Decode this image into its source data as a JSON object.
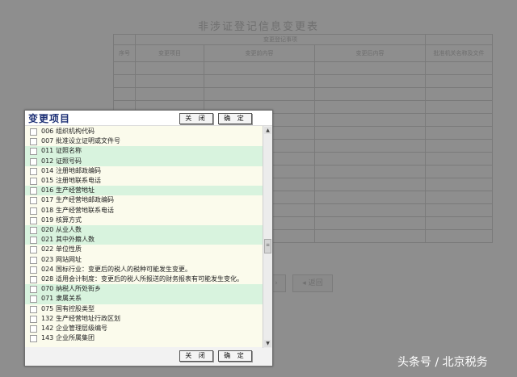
{
  "background_form": {
    "title": "非涉证登记信息变更表",
    "header_group": "变更登记事项",
    "columns": [
      "序号",
      "变更项目",
      "变更前内容",
      "变更后内容",
      "批准机关名称及文件"
    ],
    "button_right": "返回"
  },
  "dialog": {
    "title": "变更项目",
    "close_label": "关 闭",
    "ok_label": "确 定",
    "items": [
      {
        "code": "006",
        "name": "组织机构代码",
        "highlighted": false
      },
      {
        "code": "007",
        "name": "批准设立证明或文件号",
        "highlighted": false
      },
      {
        "code": "011",
        "name": "证照名称",
        "highlighted": true
      },
      {
        "code": "012",
        "name": "证照号码",
        "highlighted": true
      },
      {
        "code": "014",
        "name": "注册地邮政编码",
        "highlighted": false
      },
      {
        "code": "015",
        "name": "注册地联系电话",
        "highlighted": false
      },
      {
        "code": "016",
        "name": "生产经营地址",
        "highlighted": true
      },
      {
        "code": "017",
        "name": "生产经营地邮政编码",
        "highlighted": false
      },
      {
        "code": "018",
        "name": "生产经营地联系电话",
        "highlighted": false
      },
      {
        "code": "019",
        "name": "核算方式",
        "highlighted": false
      },
      {
        "code": "020",
        "name": "从业人数",
        "highlighted": true
      },
      {
        "code": "021",
        "name": "其中外籍人数",
        "highlighted": true
      },
      {
        "code": "022",
        "name": "单位性质",
        "highlighted": false
      },
      {
        "code": "023",
        "name": "网站网址",
        "highlighted": false
      },
      {
        "code": "024",
        "name": "国标行业：变更后的税人的税种可能发生变更。",
        "highlighted": false
      },
      {
        "code": "028",
        "name": "适用会计制度：变更后的税人所报送的财务报表有可能发生变化。",
        "highlighted": false
      },
      {
        "code": "070",
        "name": "纳税人所处街乡",
        "highlighted": true
      },
      {
        "code": "071",
        "name": "隶属关系",
        "highlighted": true
      },
      {
        "code": "075",
        "name": "国有控股类型",
        "highlighted": false
      },
      {
        "code": "132",
        "name": "生产经营地址行政区划",
        "highlighted": false
      },
      {
        "code": "142",
        "name": "企业管理层级编号",
        "highlighted": false
      },
      {
        "code": "143",
        "name": "企业所属集团",
        "highlighted": false
      }
    ]
  },
  "watermark": "头条号 / 北京税务",
  "colors": {
    "overlay": "#8c8c8c",
    "highlight_row": "#d8f3de",
    "list_bg": "#fbfbec",
    "title_text": "#1b2e74"
  }
}
